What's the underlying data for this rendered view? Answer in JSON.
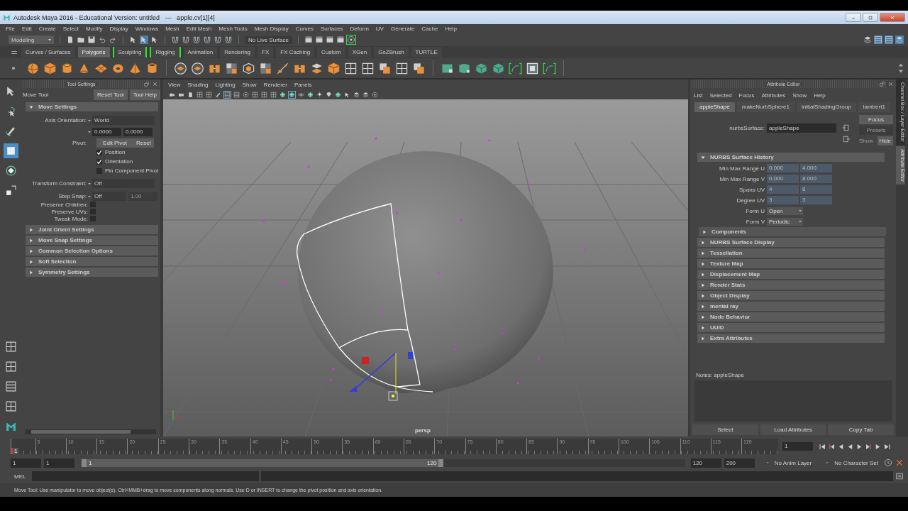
{
  "window": {
    "title": "Autodesk Maya 2016 - Educational Version: untitled   ---   apple.cv[1][4]"
  },
  "menu_bar": [
    "File",
    "Edit",
    "Create",
    "Select",
    "Modify",
    "Display",
    "Windows",
    "Mesh",
    "Edit Mesh",
    "Mesh Tools",
    "Mesh Display",
    "Curves",
    "Surfaces",
    "Deform",
    "UV",
    "Generate",
    "Cache",
    "Help"
  ],
  "status_line": {
    "menu_set": "Modeling",
    "live_surface": "No Live Surface"
  },
  "shelf_tabs": [
    {
      "label": "Curves / Surfaces",
      "selected": false,
      "highlighted": false
    },
    {
      "label": "Polygons",
      "selected": true,
      "highlighted": false
    },
    {
      "label": "Sculpting",
      "selected": false,
      "highlighted": true
    },
    {
      "label": "Rigging",
      "selected": false,
      "highlighted": true
    },
    {
      "label": "Animation",
      "selected": false,
      "highlighted": false
    },
    {
      "label": "Rendering",
      "selected": false,
      "highlighted": false
    },
    {
      "label": "FX",
      "selected": false,
      "highlighted": false
    },
    {
      "label": "FX Caching",
      "selected": false,
      "highlighted": false
    },
    {
      "label": "Custom",
      "selected": false,
      "highlighted": false
    },
    {
      "label": "XGen",
      "selected": false,
      "highlighted": false
    },
    {
      "label": "GoZBrush",
      "selected": false,
      "highlighted": false
    },
    {
      "label": "TURTLE",
      "selected": false,
      "highlighted": false
    }
  ],
  "toolbox": [
    {
      "kind": "select",
      "selected": false
    },
    {
      "kind": "lasso",
      "selected": false
    },
    {
      "kind": "paint",
      "selected": false
    },
    {
      "kind": "move",
      "selected": true
    },
    {
      "kind": "rotate",
      "selected": false
    },
    {
      "kind": "scale",
      "selected": false
    }
  ],
  "tool_settings": {
    "panel_title": "Tool Settings",
    "tool_name": "Move Tool",
    "buttons": [
      "Reset Tool",
      "Tool Help"
    ],
    "section": {
      "label": "Move Settings",
      "expanded": true
    },
    "axis_orientation": {
      "label": "Axis Orientation:",
      "value": "World"
    },
    "axis_values": [
      "0.0000",
      "0.0000"
    ],
    "pivot": {
      "label": "Pivot:",
      "buttons": [
        "Edit Pivot",
        "Reset"
      ]
    },
    "pivot_options": [
      {
        "label": "Position",
        "checked": true
      },
      {
        "label": "Orientation",
        "checked": true
      },
      {
        "label": "Pin Component Pivot",
        "checked": false
      }
    ],
    "transform_constraint": {
      "label": "Transform Constraint:",
      "value": "Off"
    },
    "step_snap": {
      "label": "Step Snap:",
      "value": "Off",
      "amount": "1.00",
      "amount_disabled": true
    },
    "preserve": [
      {
        "label": "Preserve Children:",
        "checked": false
      },
      {
        "label": "Preserve UVs:",
        "checked": false
      },
      {
        "label": "Tweak Mode:",
        "checked": false
      }
    ],
    "sections": [
      {
        "label": "Joint Orient Settings",
        "expanded": false
      },
      {
        "label": "Move Snap Settings",
        "expanded": false
      },
      {
        "label": "Common Selection Options",
        "expanded": false
      },
      {
        "label": "Soft Selection",
        "expanded": false
      },
      {
        "label": "Symmetry Settings",
        "expanded": false
      }
    ]
  },
  "viewport": {
    "menu": [
      "View",
      "Shading",
      "Lighting",
      "Show",
      "Renderer",
      "Panels"
    ],
    "camera": "persp"
  },
  "attribute_editor": {
    "panel_title": "Attribute Editor",
    "menu": [
      "List",
      "Selected",
      "Focus",
      "Attributes",
      "Show",
      "Help"
    ],
    "tabs": [
      {
        "label": "appleShape",
        "selected": true
      },
      {
        "label": "makeNurbSphere1",
        "selected": false
      },
      {
        "label": "initialShadingGroup",
        "selected": false
      },
      {
        "label": "lambert1",
        "selected": false
      }
    ],
    "node_label": "nurbsSurface:",
    "node_name": "appleShape",
    "side_buttons": [
      {
        "label": "Focus",
        "disabled": false
      },
      {
        "label": "Presets",
        "disabled": true
      }
    ],
    "show_label": "Show",
    "hide_button": "Hide",
    "history": {
      "label": "NURBS Surface History",
      "expanded": true,
      "rows": [
        {
          "label": "Min Max Range U",
          "values": [
            "0.000",
            "4.000"
          ]
        },
        {
          "label": "Min Max Range V",
          "values": [
            "0.000",
            "8.000"
          ]
        },
        {
          "label": "Spans UV",
          "values": [
            "4",
            "8"
          ]
        },
        {
          "label": "Degree UV",
          "values": [
            "3",
            "3"
          ]
        }
      ],
      "forms": [
        {
          "label": "Form U",
          "value": "Open"
        },
        {
          "label": "Form V",
          "value": "Periodic"
        }
      ],
      "subsections": [
        {
          "label": "Components",
          "expanded": false
        }
      ]
    },
    "sections": [
      {
        "label": "NURBS Surface Display",
        "expanded": false
      },
      {
        "label": "Tessellation",
        "expanded": false
      },
      {
        "label": "Texture Map",
        "expanded": false
      },
      {
        "label": "Displacement Map",
        "expanded": false
      },
      {
        "label": "Render Stats",
        "expanded": false
      },
      {
        "label": "Object Display",
        "expanded": false
      },
      {
        "label": "mental ray",
        "expanded": false
      },
      {
        "label": "Node Behavior",
        "expanded": false
      },
      {
        "label": "UUID",
        "expanded": false
      },
      {
        "label": "Extra Attributes",
        "expanded": false
      }
    ],
    "notes_label": "Notes:  appleShape",
    "bottom_buttons": [
      "Select",
      "Load Attributes",
      "Copy Tab"
    ]
  },
  "side_tabs": [
    {
      "label": "Channel Box / Layer Editor",
      "selected": false
    },
    {
      "label": "Attribute Editor",
      "selected": true
    }
  ],
  "timeline": {
    "current_frame": "1",
    "ticks": [
      "5",
      "10",
      "15",
      "20",
      "25",
      "30",
      "35",
      "40",
      "45",
      "50",
      "55",
      "60",
      "65",
      "70",
      "75",
      "80",
      "85",
      "90",
      "95",
      "100",
      "105",
      "110",
      "115",
      "120"
    ],
    "frame_field": "1"
  },
  "range": {
    "start": "1",
    "playback_start": "1",
    "slider_start": "1",
    "slider_end": "120",
    "level": 0.6,
    "playback_end": "120",
    "end": "200",
    "anim_layer": "No Anim Layer",
    "character_set": "No Character Set"
  },
  "command_line": {
    "language": "MEL"
  },
  "help_line": "Move Tool: Use manipulator to move object(s). Ctrl+MMB+drag to move components along normals. Use D or INSERT to change the pivot position and axis orientation."
}
